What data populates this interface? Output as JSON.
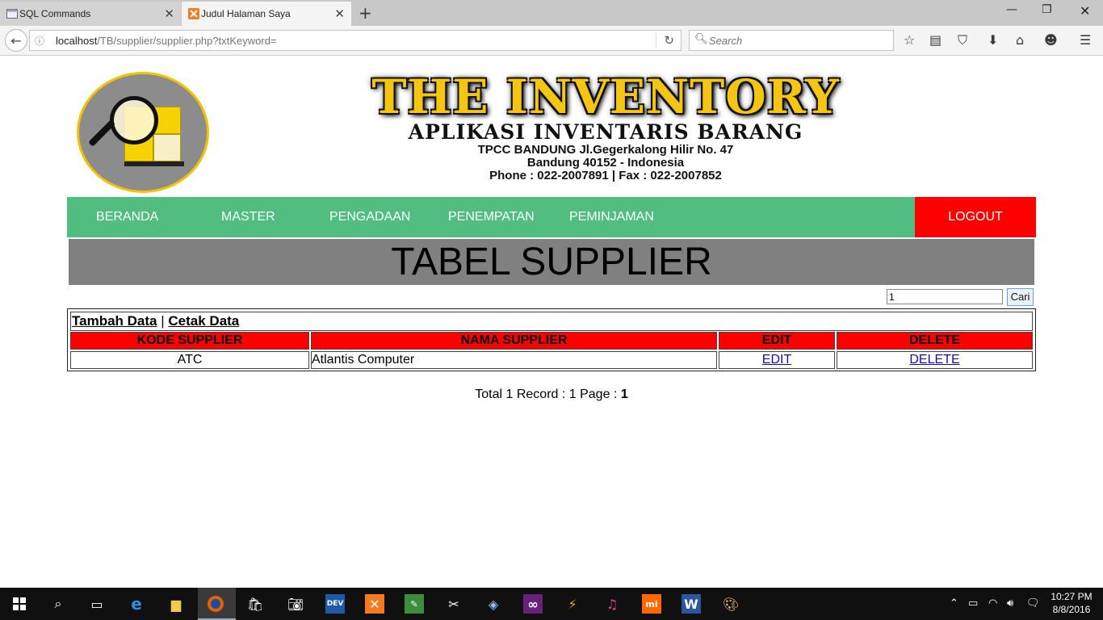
{
  "browser": {
    "tabs": [
      {
        "title": "SQL Commands",
        "active": false
      },
      {
        "title": "Judul Halaman Saya",
        "active": true
      }
    ],
    "url_host": "localhost",
    "url_path": "/TB/supplier/supplier.php?txtKeyword=",
    "search_placeholder": "Search"
  },
  "header": {
    "title": "THE INVENTORY",
    "subtitle": "APLIKASI INVENTARIS BARANG",
    "address_line1": "TPCC BANDUNG Jl.Gegerkalong Hilir No. 47",
    "address_line2": "Bandung 40152 - Indonesia",
    "address_line3": "Phone : 022-2007891 | Fax : 022-2007852"
  },
  "menu": {
    "items": [
      "BERANDA",
      "MASTER",
      "PENGADAAN",
      "PENEMPATAN",
      "PEMINJAMAN"
    ],
    "logout": "LOGOUT",
    "color": "#52bd80",
    "logout_color": "#ff0000"
  },
  "page": {
    "title": "TABEL SUPPLIER",
    "search_value": "1",
    "search_button": "Cari",
    "add_link": "Tambah Data",
    "separator": "|",
    "print_link": "Cetak Data"
  },
  "table": {
    "headers": [
      "KODE SUPPLIER",
      "NAMA SUPPLIER",
      "EDIT",
      "DELETE"
    ],
    "rows": [
      {
        "kode": "ATC",
        "nama": "Atlantis Computer",
        "edit": "EDIT",
        "delete": "DELETE"
      }
    ]
  },
  "footer": {
    "prefix": "Total 1 Record : 1 Page : ",
    "current_page": "1"
  },
  "taskbar": {
    "time": "10:27 PM",
    "date": "8/8/2016"
  }
}
